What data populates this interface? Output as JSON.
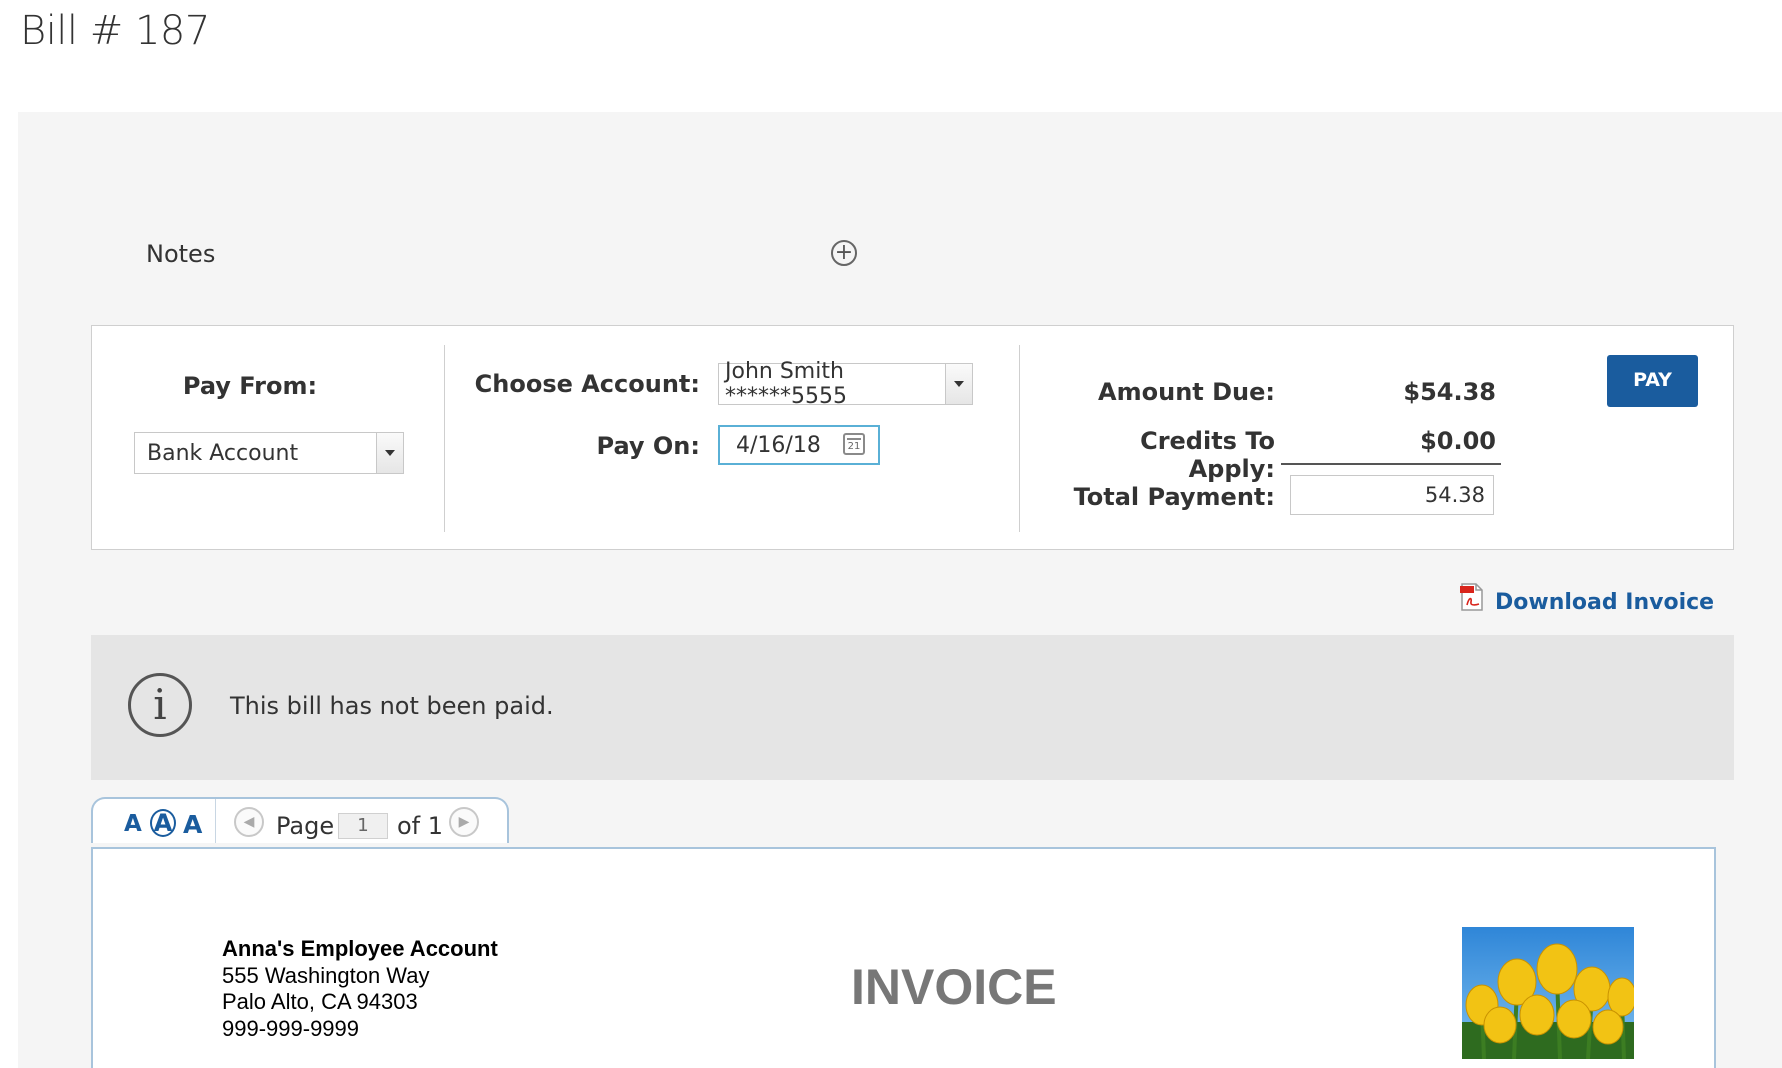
{
  "page": {
    "title": "Bill # 187"
  },
  "notes": {
    "label": "Notes"
  },
  "pay_from": {
    "label": "Pay From:",
    "selected": "Bank Account"
  },
  "account": {
    "choose_label": "Choose Account:",
    "selected": "John Smith ******5555",
    "pay_on_label": "Pay On:",
    "pay_on_value": "4/16/18",
    "calendar_day": "21"
  },
  "summary": {
    "amount_due_label": "Amount Due:",
    "amount_due_value": "$54.38",
    "credits_label": "Credits To Apply:",
    "credits_value": "$0.00",
    "total_label": "Total Payment:",
    "total_value": "54.38",
    "pay_button": "PAY"
  },
  "download": {
    "pdf_badge": "PDF",
    "label": "Download Invoice"
  },
  "notice": {
    "icon_glyph": "i",
    "text": "This bill has not been paid."
  },
  "viewer": {
    "font_small": "A",
    "font_medium": "A",
    "font_large": "A",
    "page_label": "Page",
    "page_value": "1",
    "page_of": "of 1"
  },
  "invoice": {
    "company": "Anna's Employee Account",
    "address1": "555 Washington Way",
    "address2": "Palo Alto, CA 94303",
    "phone": "999-999-9999",
    "title": "INVOICE"
  },
  "colors": {
    "accent": "#1a5c9e",
    "panel_bg": "#f5f5f5",
    "notice_bg": "#e5e5e5",
    "date_border": "#5ab0d6"
  },
  "icons": {
    "notes_add": "plus-circle-icon",
    "select_arrow": "caret-down-icon",
    "calendar": "calendar-icon",
    "pdf": "pdf-file-icon",
    "info": "info-circle-icon",
    "prev": "arrow-left-circle-icon",
    "next": "arrow-right-circle-icon"
  }
}
